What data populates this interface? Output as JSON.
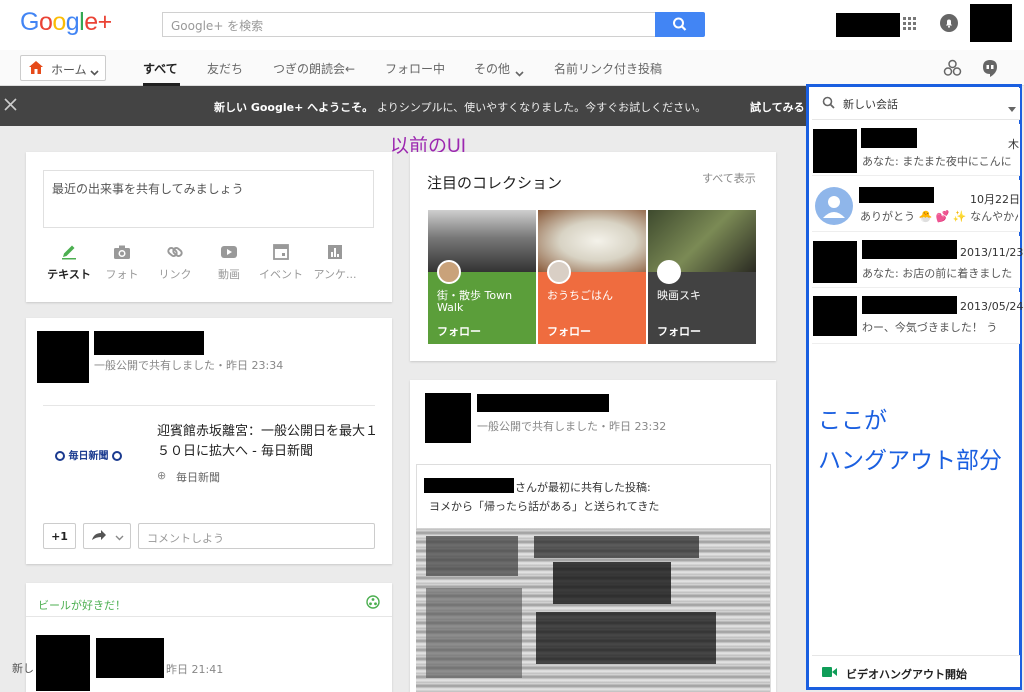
{
  "header": {
    "logo": "Google+",
    "search_placeholder": "Google+ を検索"
  },
  "nav": {
    "home_label": "ホーム",
    "tabs": [
      "すべて",
      "友だち",
      "つぎの朗読会←",
      "フォロー中",
      "その他",
      "名前リンク付き投稿"
    ]
  },
  "banner": {
    "text_bold": "新しい Google+ へようこそ。",
    "text": "よりシンプルに、使いやすくなりました。今すぐお試しください。",
    "action": "試してみる"
  },
  "annotation_top": "以前のUI",
  "compose": {
    "placeholder": "最近の出来事を共有してみましょう",
    "actions": [
      "テキスト",
      "フォト",
      "リンク",
      "動画",
      "イベント",
      "アンケ..."
    ]
  },
  "post1": {
    "meta": "一般公開で共有しました・昨日 23:34",
    "link_title": "迎賓館赤坂離宮：一般公開日を最大１５０日に拡大へ - 毎日新聞",
    "link_logo": "毎日新聞",
    "link_source": "毎日新聞",
    "plus_one": "+1",
    "comment_placeholder": "コメントしよう"
  },
  "community_card": {
    "title": "ビールが好きだ！",
    "meta": "昨日 21:41",
    "text_prefix": "新し"
  },
  "collections": {
    "title": "注目のコレクション",
    "view_all": "すべて表示",
    "items": [
      {
        "name": "街・散歩 Town Walk",
        "follow": "フォロー",
        "color": "#5b9e3a"
      },
      {
        "name": "おうちごはん",
        "follow": "フォロー",
        "color": "#ef6c3f"
      },
      {
        "name": "映画スキ",
        "follow": "フォロー",
        "color": "#424242"
      }
    ]
  },
  "post2": {
    "meta": "一般公開で共有しました・昨日 23:32",
    "shared_suffix": "さんが最初に共有した投稿:",
    "shared_text": "ヨメから「帰ったら話がある」と送られてきた"
  },
  "hangouts": {
    "search_label": "新しい会話",
    "conversations": [
      {
        "date": "木",
        "message": "あなた: またまた夜中にこんに"
      },
      {
        "date": "10月22日",
        "message": "ありがとう 🐣 💕 ✨ なんやかん"
      },
      {
        "date": "2013/11/23",
        "message": "あなた: お店の前に着きました"
      },
      {
        "date": "2013/05/24",
        "message": "わー、今気づきました！ う"
      }
    ],
    "video_button": "ビデオハングアウト開始"
  },
  "annotation_side": [
    "ここが",
    "ハングアウト部分"
  ],
  "colors": {
    "accent_blue": "#4285f4",
    "annotation_blue": "#1a5fe0",
    "annotation_purple": "#9c27b0",
    "community_green": "#4caf50"
  }
}
